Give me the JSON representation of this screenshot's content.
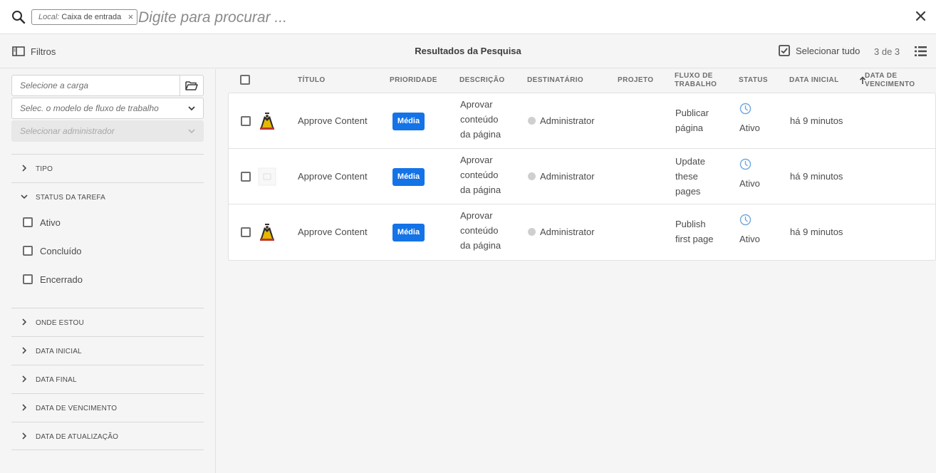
{
  "search": {
    "tag_key": "Local:",
    "tag_value": "Caixa de entrada",
    "tag_close": "×",
    "placeholder": "Digite para procurar ..."
  },
  "actionbar": {
    "filters_label": "Filtros",
    "title": "Resultados da Pesquisa",
    "select_all_label": "Selecionar tudo",
    "count": "3 de 3"
  },
  "sidebar": {
    "payload_placeholder": "Selecione a carga",
    "workflow_model_placeholder": "Selec. o modelo de fluxo de trabalho",
    "admin_placeholder": "Selecionar administrador",
    "sections": {
      "tipo": "TIPO",
      "status": "STATUS DA TAREFA",
      "onde_estou": "ONDE ESTOU",
      "data_inicial": "DATA INICIAL",
      "data_final": "DATA FINAL",
      "data_vencimento": "DATA DE VENCIMENTO",
      "data_atualizacao": "DATA DE ATUALIZAÇÃO"
    },
    "status_options": [
      "Ativo",
      "Concluído",
      "Encerrado"
    ]
  },
  "table": {
    "headers": {
      "titulo": "TÍTULO",
      "prioridade": "PRIORIDADE",
      "descricao": "DESCRIÇÃO",
      "destinatario": "DESTINATÁRIO",
      "projeto": "PROJETO",
      "fluxo1": "FLUXO DE",
      "fluxo2": "TRABALHO",
      "status": "STATUS",
      "data_inicial": "DATA INICIAL",
      "venc1": "DATA DE",
      "venc2": "VENCIMENTO"
    },
    "rows": [
      {
        "title": "Approve Content",
        "priority": "Média",
        "desc": [
          "Aprovar",
          "conteúdo",
          "da página"
        ],
        "assignee": "Administrator",
        "workflow": [
          "Publicar",
          "página"
        ],
        "status": "Ativo",
        "start": "há 9 minutos"
      },
      {
        "title": "Approve Content",
        "priority": "Média",
        "desc": [
          "Aprovar",
          "conteúdo",
          "da página"
        ],
        "assignee": "Administrator",
        "workflow": [
          "Update",
          "these",
          "pages"
        ],
        "status": "Ativo",
        "start": "há 9 minutos"
      },
      {
        "title": "Approve Content",
        "priority": "Média",
        "desc": [
          "Aprovar",
          "conteúdo",
          "da página"
        ],
        "assignee": "Administrator",
        "workflow": [
          "Publish",
          "first page"
        ],
        "status": "Ativo",
        "start": "há 9 minutos"
      }
    ]
  },
  "colors": {
    "accent": "#1473e6",
    "status_icon": "#6fa7e0"
  }
}
